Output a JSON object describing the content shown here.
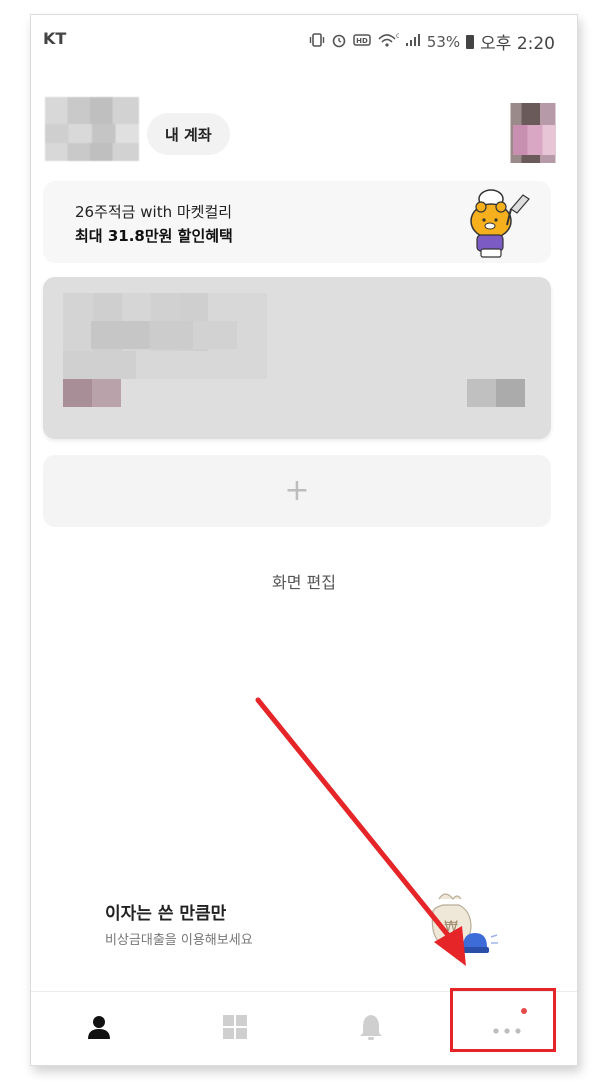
{
  "status_bar": {
    "carrier": "KT",
    "battery": "53%",
    "time": "오후 2:20"
  },
  "header": {
    "my_account_label": "내 계좌"
  },
  "promo": {
    "line1": "26주적금 with 마켓컬리",
    "line2": "최대 31.8만원 할인혜택"
  },
  "add_card": {
    "plus": "+"
  },
  "edit_screen_label": "화면 편집",
  "loan_banner": {
    "title": "이자는 쓴 만큼만",
    "subtitle": "비상금대출을 이용해보세요",
    "currency_symbol": "₩"
  },
  "bottom_nav": {
    "items": [
      {
        "icon": "person-icon"
      },
      {
        "icon": "grid-icon"
      },
      {
        "icon": "bell-icon"
      },
      {
        "icon": "more-icon",
        "badge": true
      }
    ]
  },
  "colors": {
    "annotation_red": "#e52528",
    "badge_red": "#e54b4b"
  }
}
